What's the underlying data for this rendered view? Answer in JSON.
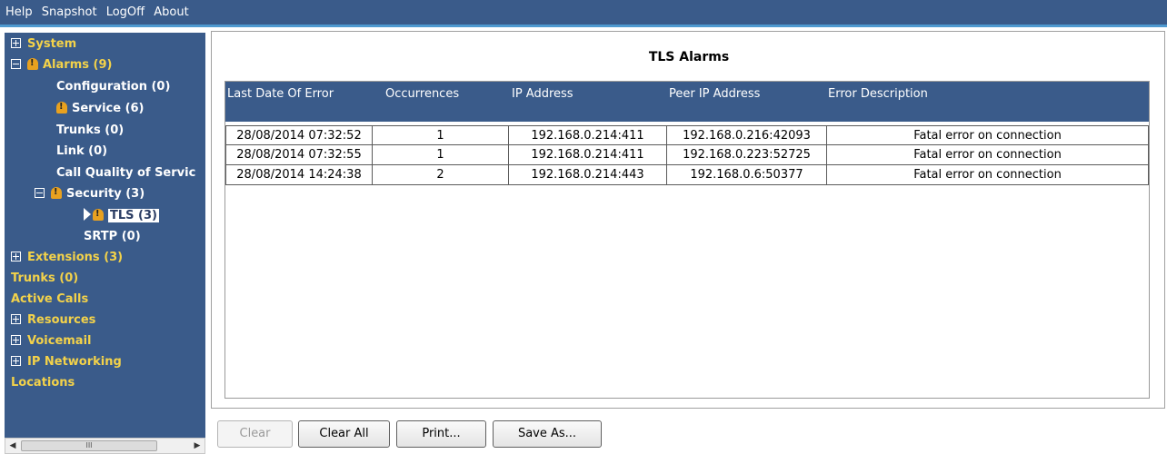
{
  "menu": {
    "items": [
      "Help",
      "Snapshot",
      "LogOff",
      "About"
    ]
  },
  "sidebar": {
    "system": "System",
    "alarms": "Alarms (9)",
    "configuration": "Configuration (0)",
    "service": "Service (6)",
    "trunks_alarm": "Trunks (0)",
    "link": "Link (0)",
    "call_quality": "Call Quality of Servic",
    "security": "Security (3)",
    "tls": "TLS (3)",
    "srtp": "SRTP (0)",
    "extensions": "Extensions (3)",
    "trunks": "Trunks (0)",
    "active_calls": "Active Calls",
    "resources": "Resources",
    "voicemail": "Voicemail",
    "ip_networking": "IP Networking",
    "locations": "Locations",
    "scroll_grip": "III"
  },
  "main": {
    "title": "TLS Alarms",
    "columns": [
      "Last Date Of Error",
      "Occurrences",
      "IP Address",
      "Peer IP Address",
      "Error Description"
    ],
    "rows": [
      [
        "28/08/2014 07:32:52",
        "1",
        "192.168.0.214:411",
        "192.168.0.216:42093",
        "Fatal error on connection"
      ],
      [
        "28/08/2014 07:32:55",
        "1",
        "192.168.0.214:411",
        "192.168.0.223:52725",
        "Fatal error on connection"
      ],
      [
        "28/08/2014 14:24:38",
        "2",
        "192.168.0.214:443",
        "192.168.0.6:50377",
        "Fatal error on connection"
      ]
    ]
  },
  "buttons": {
    "clear": "Clear",
    "clear_all": "Clear All",
    "print": "Print...",
    "save_as": "Save As..."
  },
  "colors": {
    "menubar": "#3a5b8a",
    "sidebar": "#3a5b8a",
    "tree_highlight": "#f3d24a",
    "table_header": "#3a5b8a"
  }
}
